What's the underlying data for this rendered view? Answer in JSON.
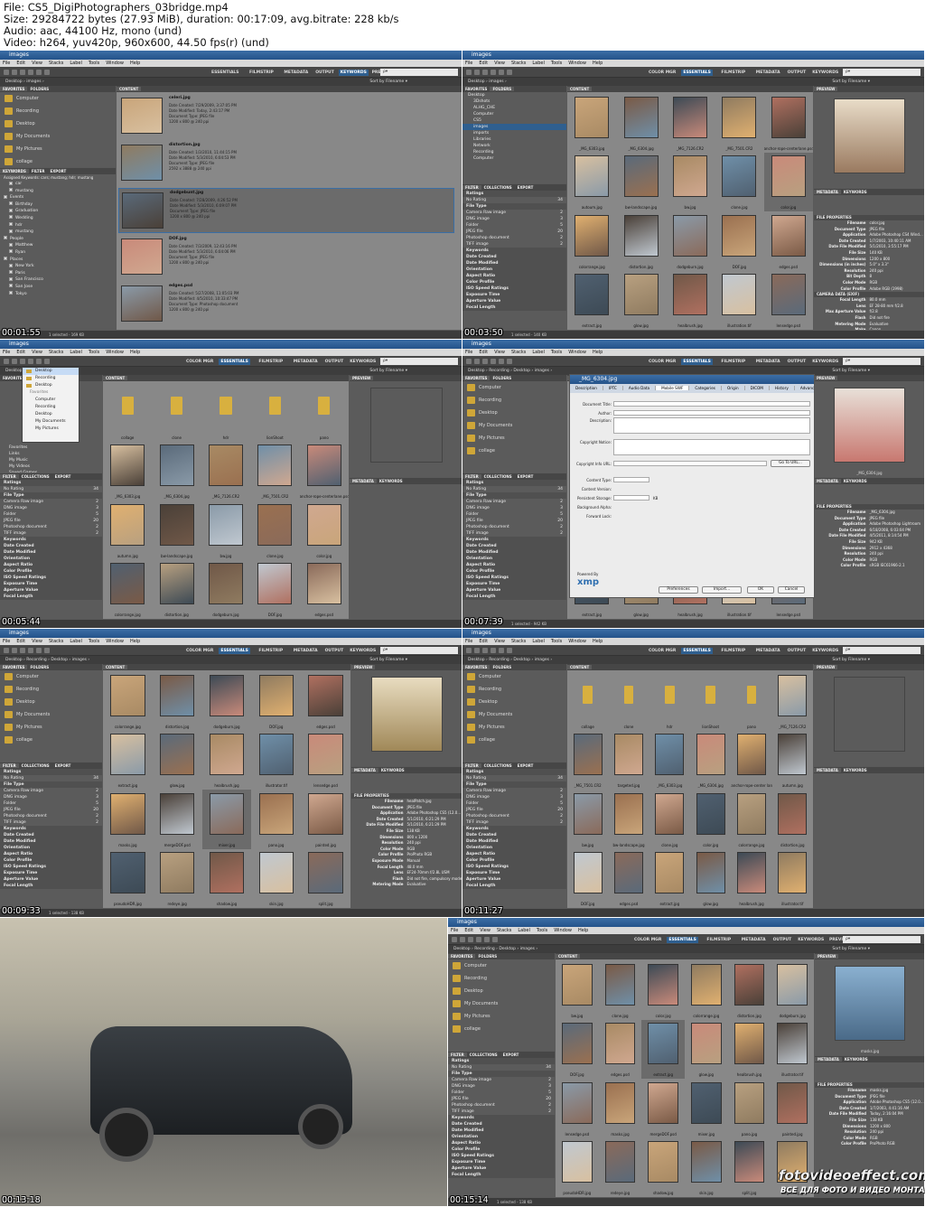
{
  "header": {
    "lines": [
      "File: CS5_DigiPhotographers_03bridge.mp4",
      "Size: 29284722 bytes (27.93 MiB), duration: 00:17:09, avg.bitrate: 228 kb/s",
      "Audio: aac, 44100 Hz, mono (und)",
      "Video: h264, yuv420p, 960x600, 44.50 fps(r) (und)"
    ]
  },
  "app": {
    "title": "images",
    "menu": [
      "File",
      "Edit",
      "View",
      "Stacks",
      "Label",
      "Tools",
      "Window",
      "Help"
    ],
    "search_placeholder": "ρ▾",
    "workspaces_a": [
      "ESSENTIALS",
      "FILMSTRIP",
      "METADATA",
      "OUTPUT",
      "KEYWORDS",
      "PREVIEW"
    ],
    "workspaces_b": [
      "COLOR MGR",
      "ESSENTIALS",
      "FILMSTRIP",
      "METADATA",
      "OUTPUT",
      "KEYWORDS",
      "PREVI ▾"
    ],
    "path": "Desktop  ›  images  ›",
    "path_b": "Desktop  ›  Recording  ›  Desktop  ›  images  ›",
    "sort_label": "Sort by Filename ▾"
  },
  "panels": {
    "favorites": "FAVORITES",
    "folders": "FOLDERS",
    "filter": "FILTER",
    "collections": "COLLECTIONS",
    "export": "EXPORT",
    "content": "CONTENT",
    "preview": "PREVIEW",
    "metadata": "METADATA",
    "keywords": "KEYWORDS"
  },
  "favorites": [
    "Computer",
    "Recording",
    "Desktop",
    "My Documents",
    "My Pictures",
    "collage"
  ],
  "favorites_hint": "Drag Favorites Here...",
  "folders_tree": [
    "Desktop",
    "3Dshots",
    "ALHG_CHE",
    "Computer",
    "CS5",
    "images",
    "imports",
    "Libraries",
    "Network",
    "Recording",
    "Computer"
  ],
  "filter_rows": [
    {
      "label": "Ratings",
      "cat": true,
      "count": ""
    },
    {
      "label": "No Rating",
      "cat": false,
      "count": "34"
    },
    {
      "label": "File Type",
      "cat": true,
      "count": ""
    },
    {
      "label": "Camera Raw image",
      "cat": false,
      "count": "2"
    },
    {
      "label": "DNG image",
      "cat": false,
      "count": "3"
    },
    {
      "label": "Folder",
      "cat": false,
      "count": "5"
    },
    {
      "label": "JPEG file",
      "cat": false,
      "count": "20"
    },
    {
      "label": "Photoshop document",
      "cat": false,
      "count": "2"
    },
    {
      "label": "TIFF image",
      "cat": false,
      "count": "2"
    },
    {
      "label": "Keywords",
      "cat": true,
      "count": ""
    },
    {
      "label": "Date Created",
      "cat": true,
      "count": ""
    },
    {
      "label": "Date Modified",
      "cat": true,
      "count": ""
    },
    {
      "label": "Orientation",
      "cat": true,
      "count": ""
    },
    {
      "label": "Aspect Ratio",
      "cat": true,
      "count": ""
    },
    {
      "label": "Color Profile",
      "cat": true,
      "count": ""
    },
    {
      "label": "ISO Speed Ratings",
      "cat": true,
      "count": ""
    },
    {
      "label": "Exposure Time",
      "cat": true,
      "count": ""
    },
    {
      "label": "Aperture Value",
      "cat": true,
      "count": ""
    },
    {
      "label": "Focal Length",
      "cat": true,
      "count": ""
    }
  ],
  "keywords_panel": {
    "assigned": "Assigned Keywords: cars; mustang; hdr; mustang",
    "items": [
      "car",
      "mustang",
      "Events",
      "Birthday",
      "Graduation",
      "Wedding",
      "hdr",
      "mustang",
      "People",
      "Matthew",
      "Ryan",
      "Places",
      "New York",
      "Paris",
      "San Francisco",
      "San Jose",
      "Tokyo"
    ]
  },
  "list_view": [
    {
      "name": "celeri.jpg",
      "meta": [
        "Date Created: 7/29/2009, 3:37:05 PM",
        "Date Modified: Today, 2:43:17 PM",
        "Document Type: JPEG file",
        "1200 x 800 @ 240 ppi"
      ]
    },
    {
      "name": "distortion.jpg",
      "meta": [
        "Date Created: 1/3/2010, 11:44:15 PM",
        "Date Modified: 5/3/2010, 6:04:53 PM",
        "Document Type: JPEG file",
        "2592 x 3888 @ 240 ppi"
      ]
    },
    {
      "name": "dodgebunt.jpg",
      "meta": [
        "Date Created: 7/28/2009, 4:26:52 PM",
        "Date Modified: 5/3/2010, 6:09:07 PM",
        "Document Type: JPEG file",
        "1200 x 800 @ 240 ppi"
      ]
    },
    {
      "name": "DOF.jpg",
      "meta": [
        "Date Created: 7/3/2009, 12:43:16 PM",
        "Date Modified: 5/3/2010, 6:04:06 PM",
        "Document Type: JPEG file",
        "1200 x 800 @ 240 ppi"
      ]
    },
    {
      "name": "edges.psd",
      "meta": [
        "Date Created: 5/27/2008, 11:05:03 PM",
        "Date Modified: 4/5/2010, 10:33:47 PM",
        "Document Type: Photoshop document",
        "1200 x 800 @ 240 ppi"
      ]
    }
  ],
  "grid_b": [
    "_MG_6303.jpg",
    "_MG_6304.jpg",
    "_MG_7126.CR2",
    "_MG_7501.CR2",
    "anchor-rope-centerlane.psd",
    "autoum.jpg",
    "bw-landscape.jpg",
    "bw.jpg",
    "clone.jpg",
    "color.jpg",
    "colorrange.jpg",
    "distortion.jpg",
    "dodgeburn.jpg",
    "DOF.jpg",
    "edges.psd",
    "extract.jpg",
    "glow.jpg",
    "healbrush.jpg",
    "illustration.tif",
    "lensedge.psd"
  ],
  "grid_c_folders": [
    "collage",
    "clone",
    "hdr",
    "lionShoot",
    "pano"
  ],
  "grid_c": [
    "_MG_6303.jpg",
    "_MG_6304.jpg",
    "_MG_7126.CR2",
    "_MG_7501.CR2",
    "anchor-rope-centerlane.psd",
    "autumn.jpg",
    "bw-landscape.jpg",
    "bw.jpg",
    "clone.jpg",
    "color.jpg",
    "colorrange.jpg",
    "distortion.jpg",
    "dodgeburn.jpg",
    "DOF.jpg",
    "edges.psd"
  ],
  "grid_e": [
    "colorrange.jpg",
    "distortion.jpg",
    "dodgeburn.jpg",
    "DOF.jpg",
    "edges.psd",
    "extract.jpg",
    "glow.jpg",
    "healbrush.jpg",
    "illustrator.tif",
    "lensedge.psd",
    "masks.jpg",
    "mergeDOF.psd",
    "mixer.jpg",
    "pano.jpg",
    "painted.jpg",
    "pseudoHDR.jpg",
    "redeye.jpg",
    "shadow.jpg",
    "skin.jpg",
    "split.jpg"
  ],
  "grid_f": [
    "collage",
    "clone",
    "hdr",
    "lionShoot",
    "pano",
    "_MG_7126.CR2",
    "_MG_7501.CR2",
    "targeted.jpg",
    "_MG_6303.jpg",
    "_MG_6304.jpg",
    "anchor-rope-center lane.psd",
    "autumn.jpg",
    "bw.jpg",
    "bw-landscape.jpg",
    "clone.jpg",
    "color.jpg",
    "colorrange.jpg",
    "distortion.jpg",
    "DOF.jpg",
    "edges.psd",
    "extract.jpg",
    "glow.jpg",
    "healbrush.jpg",
    "illustrator.tif"
  ],
  "grid_h": [
    "bw.jpg",
    "clone.jpg",
    "color.jpg",
    "colorrange.jpg",
    "distortion.jpg",
    "dodgeburn.jpg",
    "DOF.jpg",
    "edges.psd",
    "extract.jpg",
    "glow.jpg",
    "healbrush.jpg",
    "illustrator.tif",
    "lensedge.psd",
    "masks.jpg",
    "mergeDOF.psd",
    "mixer.jpg",
    "pano.jpg",
    "painted.jpg",
    "pseudoHDR.jpg",
    "redeye.jpg",
    "shadow.jpg",
    "skin.jpg",
    "split.jpg",
    "targeted.jpg"
  ],
  "metadata_b": {
    "title": "FILE PROPERTIES",
    "rows": [
      {
        "k": "Filename",
        "v": "color.jpg"
      },
      {
        "k": "Document Type",
        "v": "JPEG file"
      },
      {
        "k": "Application",
        "v": "Adobe Photoshop CS4 Wind..."
      },
      {
        "k": "Date Created",
        "v": "1/7/2003, 10:40:11 AM"
      },
      {
        "k": "Date File Modified",
        "v": "5/1/2010, 3:55:17 PM"
      },
      {
        "k": "File Size",
        "v": "140 KB"
      },
      {
        "k": "Dimensions",
        "v": "1200 x 800"
      },
      {
        "k": "Dimensions (in inches)",
        "v": "5.0\" x 3.3\""
      },
      {
        "k": "Resolution",
        "v": "240 ppi"
      },
      {
        "k": "Bit Depth",
        "v": "8"
      },
      {
        "k": "Color Mode",
        "v": "RGB"
      },
      {
        "k": "Color Profile",
        "v": "Adobe RGB (1998)"
      }
    ],
    "camera_title": "CAMERA DATA (EXIF)",
    "camera": [
      {
        "k": "Focal Length",
        "v": "80.0 mm"
      },
      {
        "k": "Lens",
        "v": "EF 28-80 mm f/2.8"
      },
      {
        "k": "Max Aperture Value",
        "v": "f/2.8"
      },
      {
        "k": "Flash",
        "v": "Did not fire"
      },
      {
        "k": "Metering Mode",
        "v": "Evaluative"
      },
      {
        "k": "Make",
        "v": "Canon"
      }
    ]
  },
  "metadata_d": {
    "rows": [
      {
        "k": "Filename",
        "v": "_MG_6304.jpg"
      },
      {
        "k": "Document Type",
        "v": "JPEG file"
      },
      {
        "k": "Application",
        "v": "Adobe Photoshop Lightroom"
      },
      {
        "k": "Date Created",
        "v": "6/18/2008, 6:03:04 PM"
      },
      {
        "k": "Date File Modified",
        "v": "4/5/2011, 8:14:54 PM"
      },
      {
        "k": "File Size",
        "v": "942 KB"
      },
      {
        "k": "Dimensions",
        "v": "2912 x 4368"
      },
      {
        "k": "Resolution",
        "v": "240 ppi"
      },
      {
        "k": "Color Mode",
        "v": "RGB"
      },
      {
        "k": "Color Profile",
        "v": "sRGB IEC61966-2.1"
      }
    ]
  },
  "metadata_e": {
    "rows": [
      {
        "k": "Filename",
        "v": "healPatch.jpg"
      },
      {
        "k": "Document Type",
        "v": "JPEG file"
      },
      {
        "k": "Application",
        "v": "Adobe Photoshop CS5 (12.0..."
      },
      {
        "k": "Date Created",
        "v": "5/1/2010, 6:21:29 PM"
      },
      {
        "k": "Date File Modified",
        "v": "5/1/2010, 6:21:29 PM"
      },
      {
        "k": "File Size",
        "v": "138 KB"
      },
      {
        "k": "Dimensions",
        "v": "800 x 1200"
      },
      {
        "k": "Resolution",
        "v": "240 ppi"
      },
      {
        "k": "Color Mode",
        "v": "RGB"
      },
      {
        "k": "Color Profile",
        "v": "ProPhoto RGB"
      },
      {
        "k": "Exposure Mode",
        "v": "Manual"
      },
      {
        "k": "Focal Length",
        "v": "48.0 mm"
      },
      {
        "k": "Lens",
        "v": "EF24-70mm f/2.8L USM"
      },
      {
        "k": "Flash",
        "v": "Did not fire, compulsory mode"
      },
      {
        "k": "Metering Mode",
        "v": "Evaluative"
      }
    ]
  },
  "metadata_h": {
    "rows": [
      {
        "k": "Filename",
        "v": "masks.jpg"
      },
      {
        "k": "Document Type",
        "v": "JPEG file"
      },
      {
        "k": "Application",
        "v": "Adobe Photoshop CS5 (12.0..."
      },
      {
        "k": "Date Created",
        "v": "1/7/2003, 4:41:16 AM"
      },
      {
        "k": "Date File Modified",
        "v": "Today, 2:16:04 PM"
      },
      {
        "k": "File Size",
        "v": "138 KB"
      },
      {
        "k": "Dimensions",
        "v": "1200 x 800"
      },
      {
        "k": "Resolution",
        "v": "240 ppi"
      },
      {
        "k": "Color Mode",
        "v": "RGB"
      },
      {
        "k": "Color Profile",
        "v": "ProPhoto RGB"
      }
    ]
  },
  "preview_captions": {
    "d": "_MG_6304.jpg",
    "h": "masks.jpg"
  },
  "dialog": {
    "title": "_MG_6304.jpg",
    "tabs": [
      "Description",
      "IPTC",
      "Audio Data",
      "Mobile SWF",
      "Categories",
      "Origin",
      "DICOM",
      "History",
      "Advanced"
    ],
    "fields": [
      "Document Title:",
      "Author:",
      "Description:",
      "Copyright Notice:",
      "Copyright Info URL:",
      "Content Type:",
      "Content Version:",
      "Persistent Storage:",
      "Background Alpha:",
      "Forward Lock:"
    ],
    "go_button": "Go To URL...",
    "unit": "KB",
    "powered": "Powered By",
    "xmp": "xmp",
    "buttons": [
      "Preferences",
      "Import...",
      "OK",
      "Cancel"
    ]
  },
  "popup": {
    "items": [
      "Desktop",
      "Recording",
      "Desktop"
    ],
    "header": "Favorites",
    "fav": [
      "Computer",
      "Recording",
      "Desktop",
      "My Documents",
      "My Pictures"
    ]
  },
  "left_tree_c": [
    "Favorites",
    "Links",
    "My Music",
    "My Videos",
    "Saved Games"
  ],
  "timestamps": [
    "00:01:55",
    "00:03:50",
    "00:05:44",
    "00:07:39",
    "00:09:33",
    "00:11:27",
    "00:13:18",
    "00:15:14"
  ],
  "status": [
    "1 selected - 169 KB",
    "1 selected - 140 KB",
    "",
    "1 selected - 942 KB",
    "1 selected - 138 KB",
    "",
    "",
    "1 selected - 138 KB"
  ],
  "watermark": {
    "line1": "fotovideoeffect.com",
    "line2": "ВСЕ ДЛЯ ФОТО И ВИДЕО МОНТАЖА!"
  },
  "colors": {
    "panel": "#5b5b5b",
    "content": "#888888",
    "accent": "#2f5f8f",
    "folder": "#d8b03f"
  }
}
